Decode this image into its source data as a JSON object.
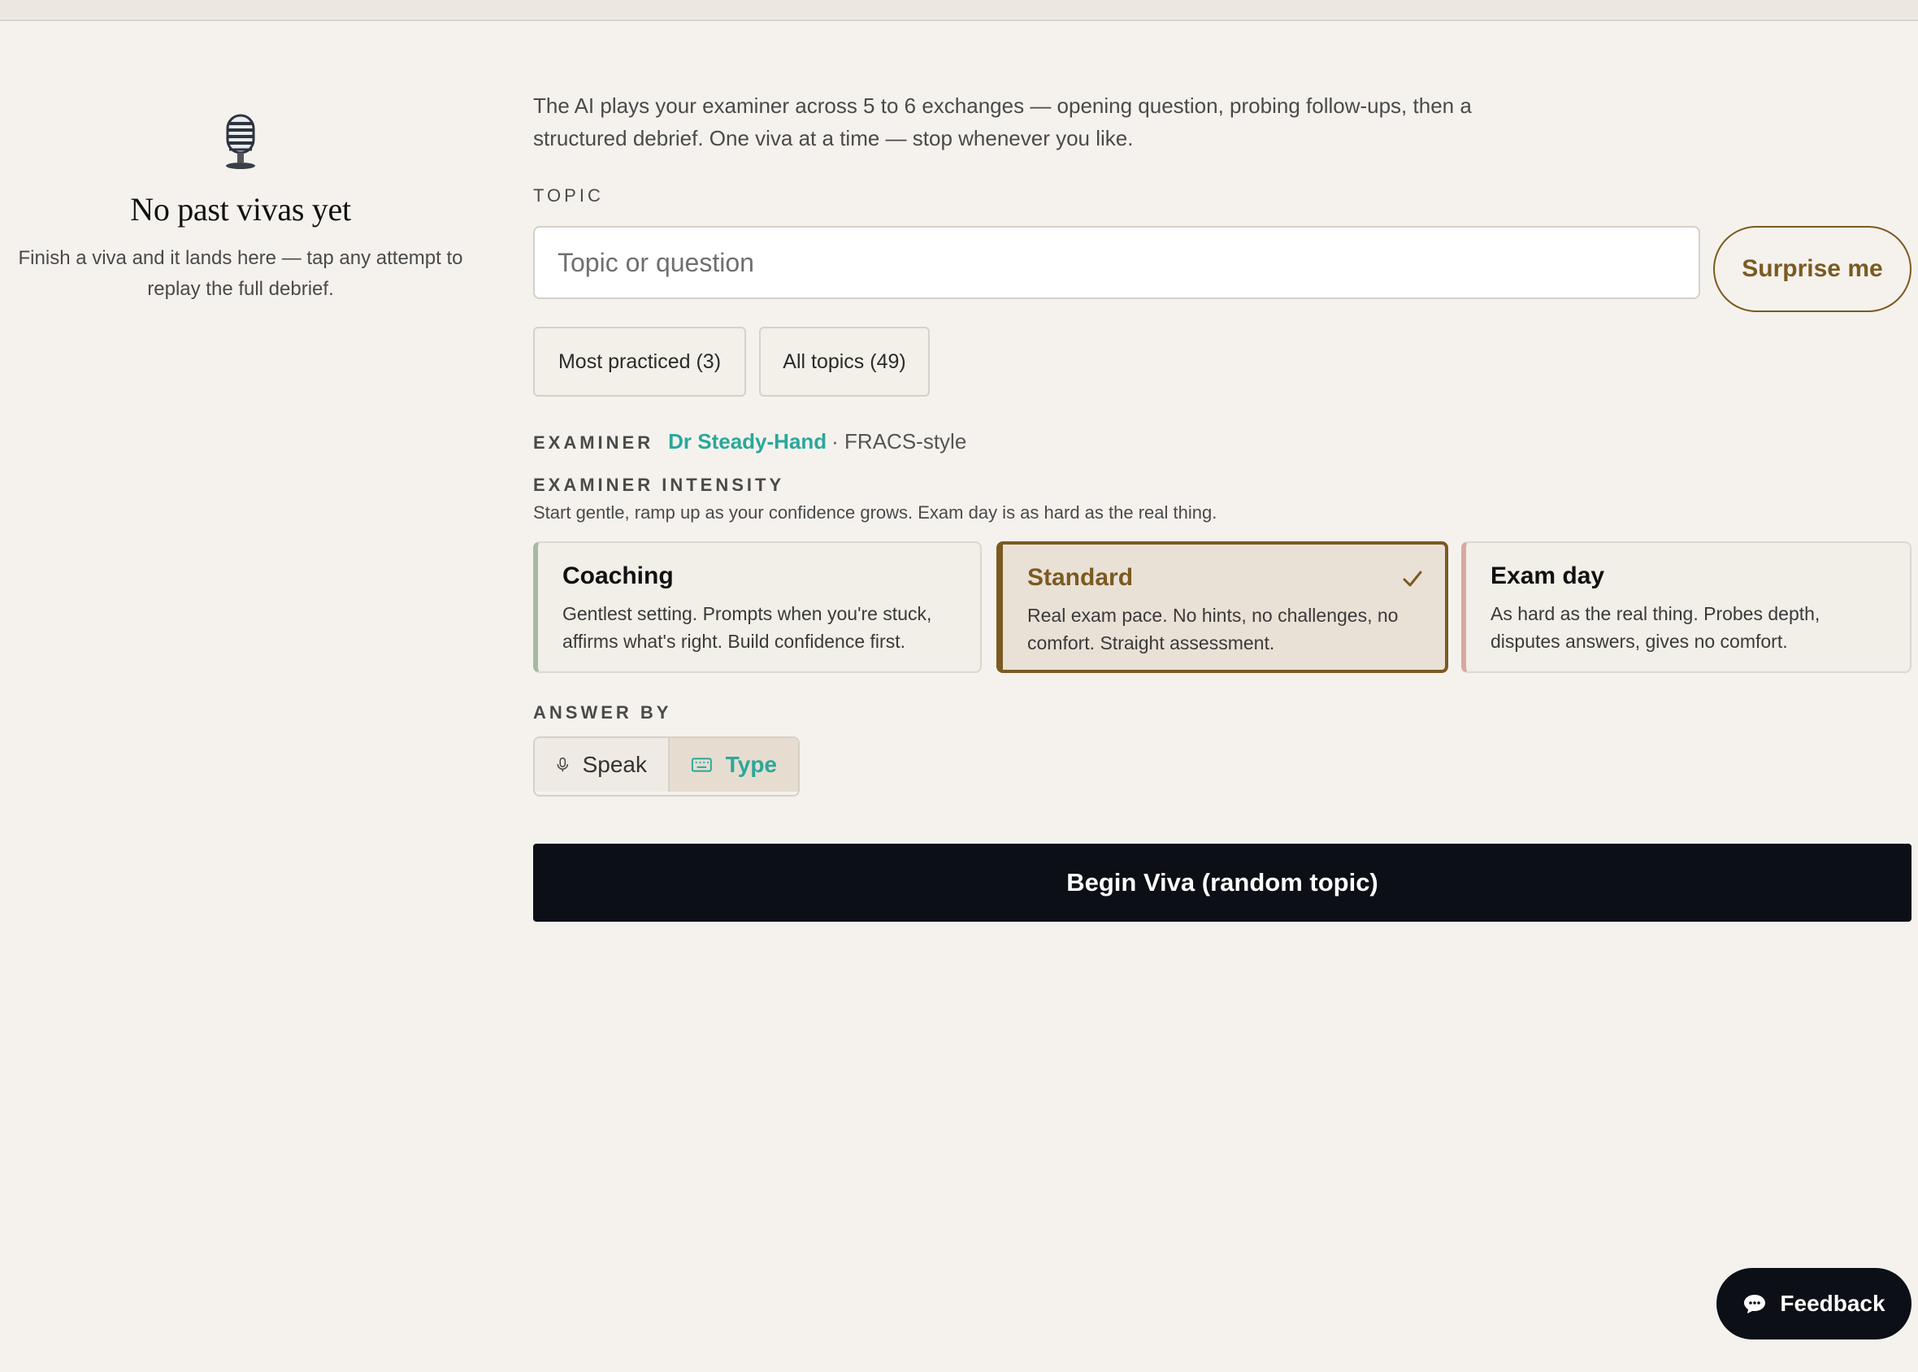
{
  "history": {
    "empty_icon": "microphone-emoji",
    "empty_title": "No past vivas yet",
    "empty_desc": "Finish a viva and it lands here — tap any attempt to replay the full debrief."
  },
  "main": {
    "intro": "The AI plays your examiner across 5 to 6 exchanges — opening question, probing follow-ups, then a structured debrief. One viva at a time — stop whenever you like.",
    "topic_label": "TOPIC",
    "topic_placeholder": "Topic or question",
    "topic_value": "",
    "surprise_label": "Surprise me",
    "chips": [
      {
        "label": "Most practiced (3)"
      },
      {
        "label": "All topics (49)"
      }
    ],
    "examiner_label": "EXAMINER",
    "examiner_name": "Dr Steady-Hand",
    "examiner_style": "· FRACS-style",
    "intensity_label": "EXAMINER INTENSITY",
    "intensity_desc": "Start gentle, ramp up as your confidence grows. Exam day is as hard as the real thing.",
    "intensity_options": [
      {
        "title": "Coaching",
        "desc": "Gentlest setting. Prompts when you're stuck, affirms what's right. Build confidence first.",
        "selected": false
      },
      {
        "title": "Standard",
        "desc": "Real exam pace. No hints, no challenges, no comfort. Straight assessment.",
        "selected": true
      },
      {
        "title": "Exam day",
        "desc": "As hard as the real thing. Probes depth, disputes answers, gives no comfort.",
        "selected": false
      }
    ],
    "answer_label": "ANSWER BY",
    "answer_options": [
      {
        "label": "Speak",
        "icon": "microphone-icon",
        "selected": false
      },
      {
        "label": "Type",
        "icon": "keyboard-icon",
        "selected": true
      }
    ],
    "begin_label": "Begin Viva (random topic)"
  },
  "feedback": {
    "label": "Feedback",
    "icon": "chat-bubble-icon"
  },
  "colors": {
    "background": "#f5f2ed",
    "accent_teal": "#2aa89a",
    "accent_brown": "#7b5a22",
    "dark_button": "#0c0f16",
    "coaching_bar": "#a6b9a6",
    "examday_bar": "#d7a8a0"
  }
}
